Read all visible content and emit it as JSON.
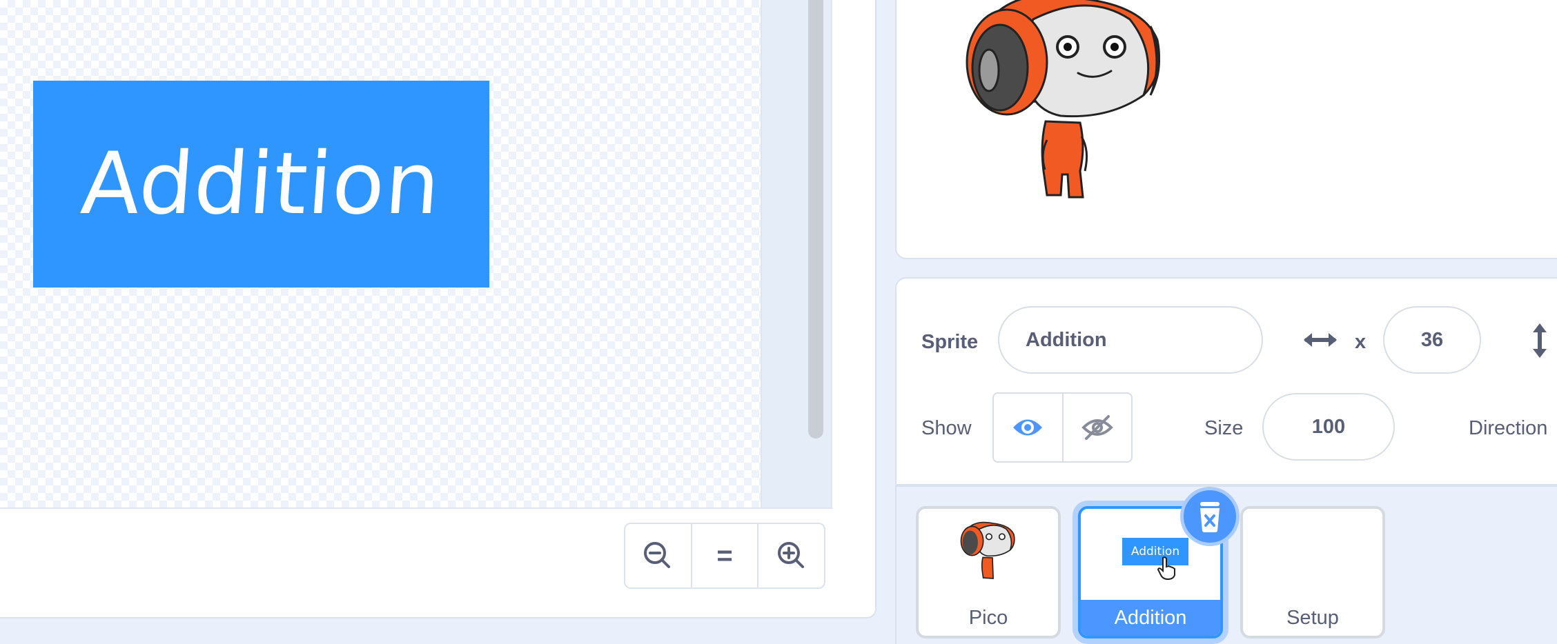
{
  "costume_canvas": {
    "shape_text": "Addition"
  },
  "zoom_controls": {
    "zoom_out": "zoom-out-icon",
    "zoom_reset": "=",
    "zoom_in": "zoom-in-icon"
  },
  "sprite_info": {
    "sprite_label": "Sprite",
    "sprite_name": "Addition",
    "x_label": "x",
    "x_value": "36",
    "show_label": "Show",
    "size_label": "Size",
    "size_value": "100",
    "direction_label": "Direction"
  },
  "sprites": [
    {
      "name": "Pico"
    },
    {
      "name": "Addition",
      "thumb_text": "Addition"
    },
    {
      "name": "Setup"
    }
  ],
  "colors": {
    "accent": "#4c97ff",
    "costume_fill": "#2f96ff",
    "pico_orange": "#f25a24"
  }
}
